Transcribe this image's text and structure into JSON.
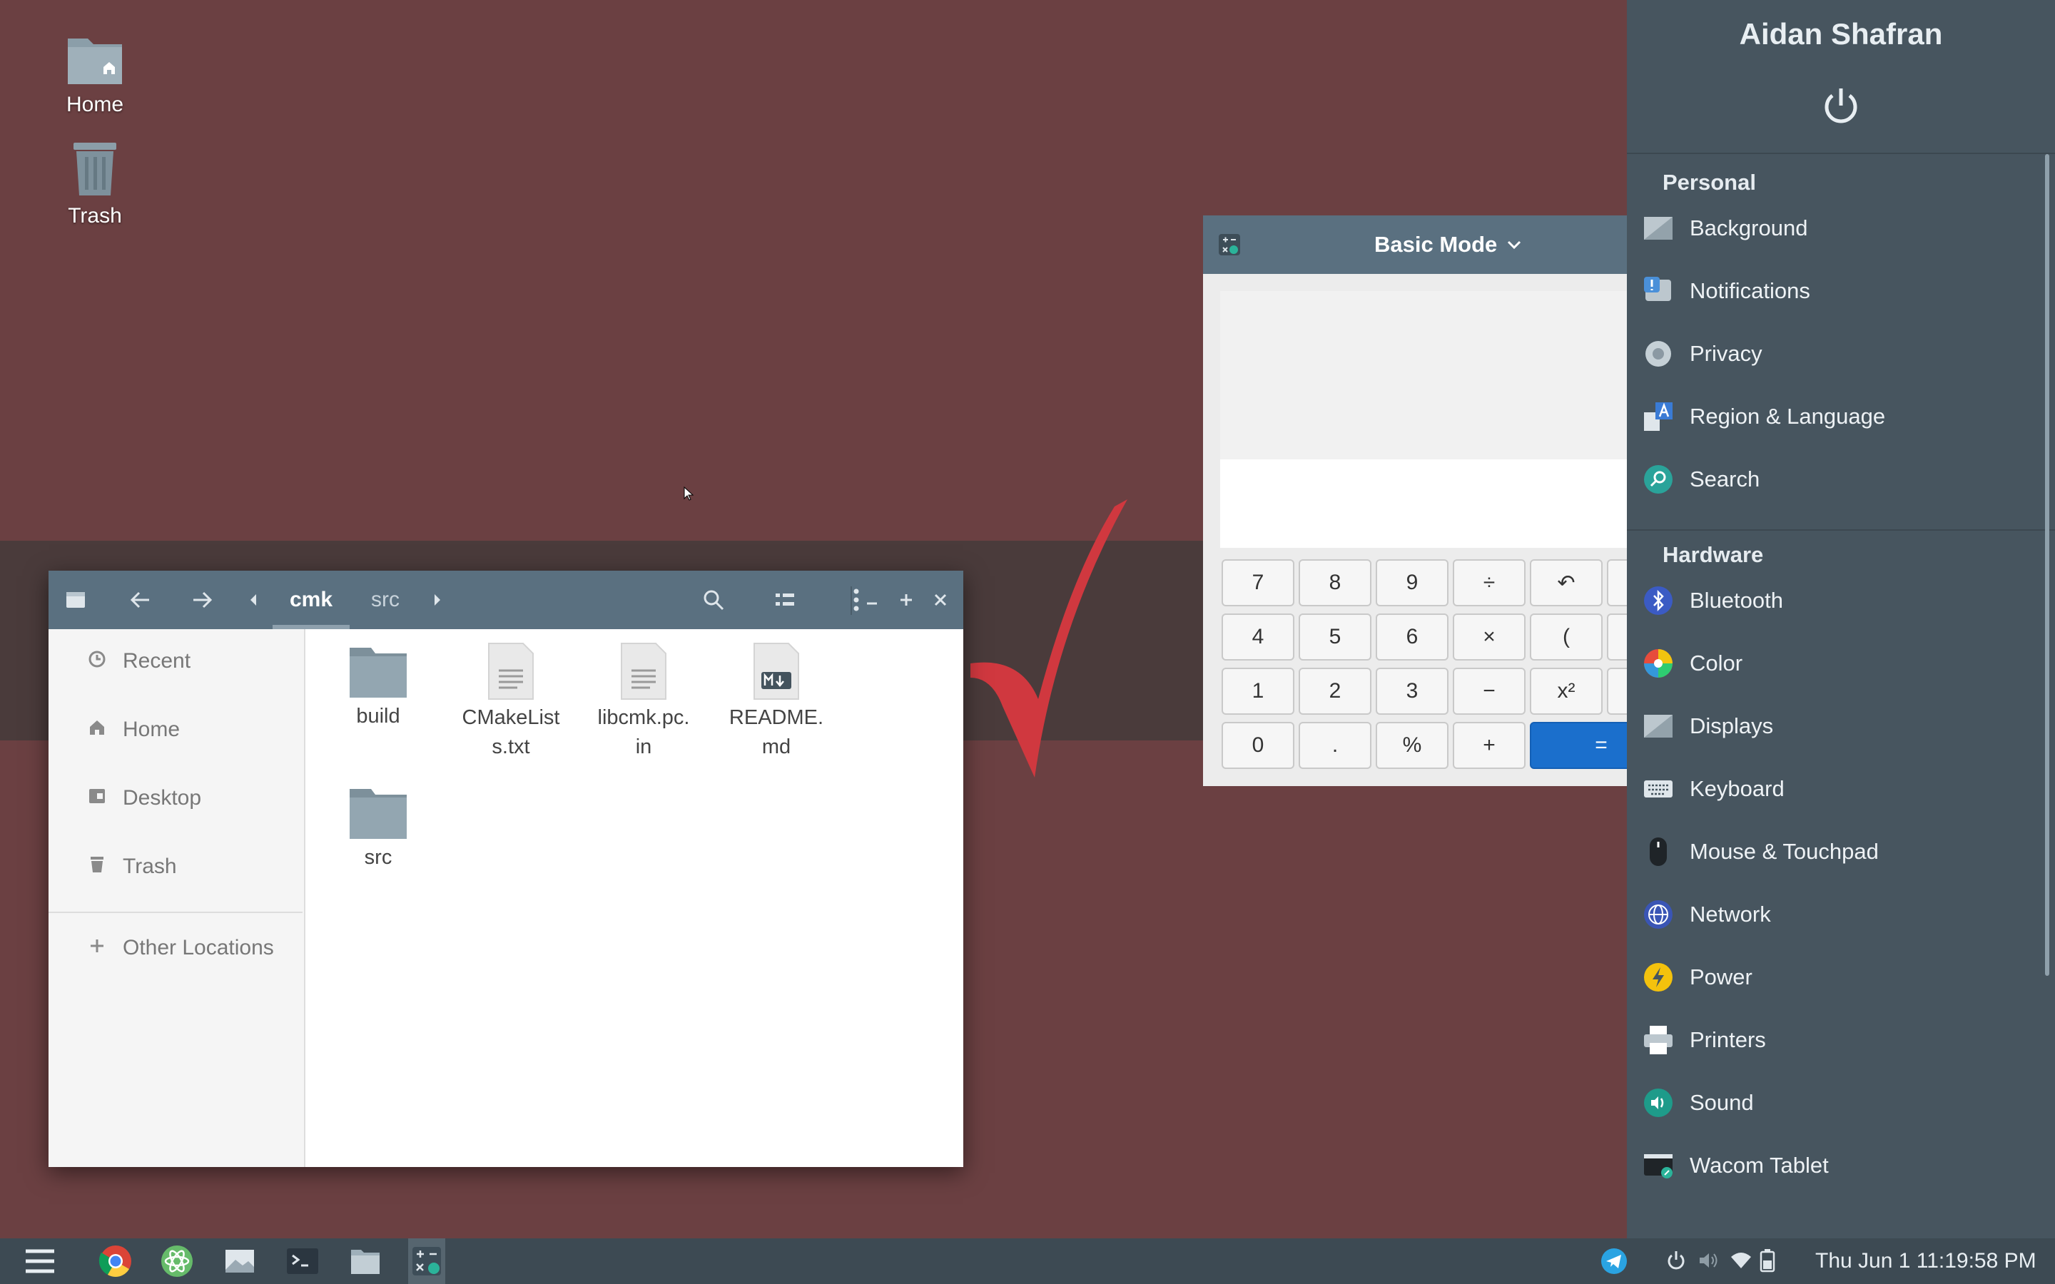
{
  "desktop": {
    "icons": [
      {
        "label": "Home",
        "icon": "home-folder-icon"
      },
      {
        "label": "Trash",
        "icon": "trash-icon"
      }
    ]
  },
  "files": {
    "breadcrumbs": [
      "cmk",
      "src"
    ],
    "sidebar": [
      {
        "label": "Recent",
        "icon": "clock-icon"
      },
      {
        "label": "Home",
        "icon": "home-icon"
      },
      {
        "label": "Desktop",
        "icon": "desktop-icon"
      },
      {
        "label": "Trash",
        "icon": "trash-icon"
      },
      {
        "label": "Other Locations",
        "icon": "plus-icon"
      }
    ],
    "items": [
      {
        "name": "build",
        "type": "folder"
      },
      {
        "name_lines": [
          "CMakeList",
          "s.txt"
        ],
        "type": "text"
      },
      {
        "name_lines": [
          "libcmk.pc.",
          "in"
        ],
        "type": "text"
      },
      {
        "name_lines": [
          "README.",
          "md"
        ],
        "type": "markdown"
      },
      {
        "name": "src",
        "type": "folder"
      }
    ]
  },
  "calculator": {
    "mode": "Basic Mode",
    "keys": [
      [
        "7",
        "8",
        "9",
        "÷",
        "↶"
      ],
      [
        "4",
        "5",
        "6",
        "×",
        "("
      ],
      [
        "1",
        "2",
        "3",
        "−",
        "x²"
      ],
      [
        "0",
        ".",
        "%",
        "+",
        "="
      ]
    ]
  },
  "settings": {
    "user": "Aidan Shafran",
    "sections": [
      {
        "title": "Personal",
        "items": [
          "Background",
          "Notifications",
          "Privacy",
          "Region & Language",
          "Search"
        ]
      },
      {
        "title": "Hardware",
        "items": [
          "Bluetooth",
          "Color",
          "Displays",
          "Keyboard",
          "Mouse & Touchpad",
          "Network",
          "Power",
          "Printers",
          "Sound",
          "Wacom Tablet"
        ]
      }
    ]
  },
  "taskbar": {
    "apps": [
      "menu-icon",
      "chrome-icon",
      "atom-icon",
      "image-viewer-icon",
      "terminal-icon",
      "files-icon",
      "calculator-icon"
    ],
    "clock": "Thu Jun  1 11:19:58 PM"
  },
  "colors": {
    "desktop_bg": "#6b4042",
    "header": "#5a7080",
    "panel": "#47555f",
    "accent": "#1b6fcc"
  }
}
